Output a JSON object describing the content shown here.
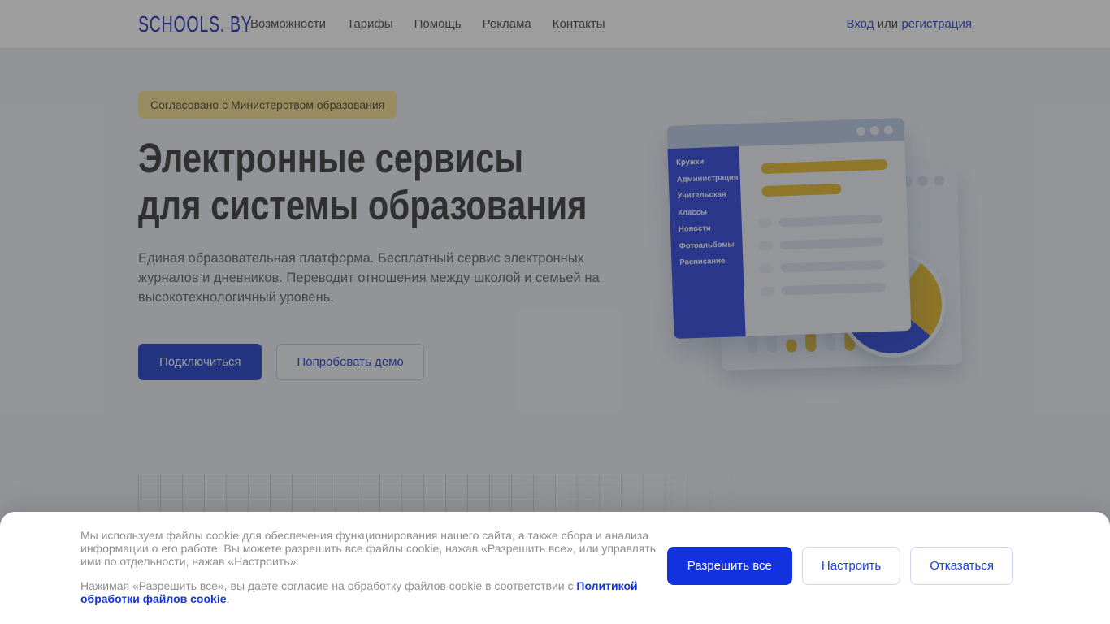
{
  "brand": {
    "logo": "SCHOOLS. BY"
  },
  "nav": {
    "items": [
      {
        "label": "Возможности"
      },
      {
        "label": "Тарифы"
      },
      {
        "label": "Помощь"
      },
      {
        "label": "Реклама"
      },
      {
        "label": "Контакты"
      }
    ]
  },
  "auth": {
    "login": "Вход",
    "separator": " или ",
    "register": "регистрация"
  },
  "hero": {
    "badge": "Согласовано с Министерством образования",
    "title_line1": "Электронные сервисы",
    "title_line2": "для системы образования",
    "description": "Единая образовательная платформа. Бесплатный сервис электронных журналов и дневников. Переводит отношения между школой и семьей на высокотехнологичный уровень.",
    "cta_primary": "Подключиться",
    "cta_secondary": "Попробовать демо"
  },
  "illustration": {
    "sidebar_items": [
      "Кружки",
      "Администрация",
      "Учительская",
      "Классы",
      "Новости",
      "Фотоальбомы",
      "Расписание"
    ]
  },
  "cookie_banner": {
    "paragraph1": "Мы используем файлы cookie для обеспечения функционирования нашего сайта, а также сбора и анализа информации о его работе. Вы можете разрешить все файлы cookie, нажав «Разрешить все», или управлять ими по отдельности, нажав «Настроить».",
    "paragraph2_prefix": "Нажимая «Разрешить все», вы даете согласие на обработку файлов cookie в соответствии с ",
    "paragraph2_link": "Политикой обработки файлов cookie",
    "paragraph2_suffix": ".",
    "buttons": {
      "accept": "Разрешить все",
      "configure": "Настроить",
      "decline": "Отказаться"
    }
  },
  "colors": {
    "primary_blue": "#1132dc",
    "hero_blue": "#3550cf",
    "link_blue": "#3a55dd",
    "badge_bg": "#f7e29a",
    "accent_yellow": "#e3bd3e",
    "sidebar_blue": "#4156e0",
    "page_bg": "#eef1f5"
  }
}
